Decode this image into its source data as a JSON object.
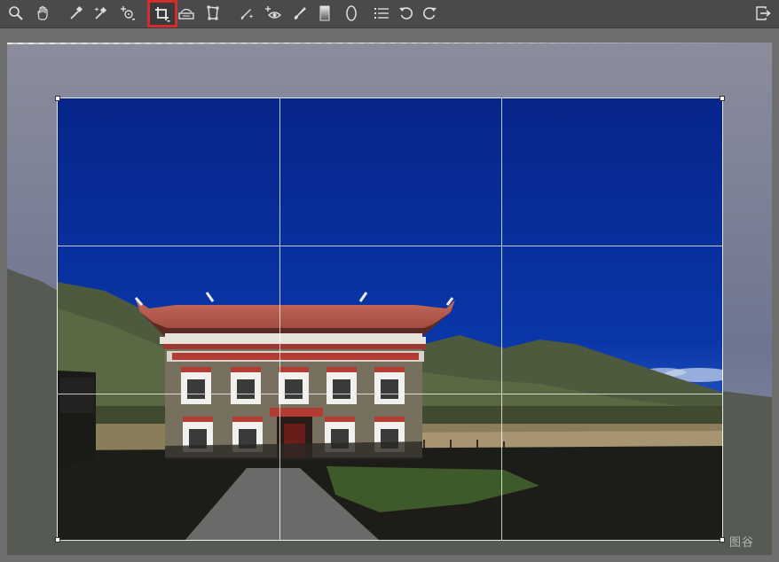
{
  "toolbar": {
    "tools": [
      {
        "name": "zoom",
        "icon": "magnifier-icon"
      },
      {
        "name": "hand",
        "icon": "hand-icon"
      },
      {
        "name": "color-picker",
        "icon": "eyedropper-icon"
      },
      {
        "name": "white-balance-picker",
        "icon": "sparkle-eyedropper-icon"
      },
      {
        "name": "color-sampler",
        "icon": "target-plus-icon"
      },
      {
        "name": "crop",
        "icon": "crop-icon",
        "active": true
      },
      {
        "name": "straighten",
        "icon": "level-icon"
      },
      {
        "name": "transform",
        "icon": "transform-icon"
      },
      {
        "name": "spot-removal",
        "icon": "brush-sparkle-icon"
      },
      {
        "name": "red-eye",
        "icon": "eye-plus-icon"
      },
      {
        "name": "adjustment-brush",
        "icon": "paintbrush-icon"
      },
      {
        "name": "graduated-filter",
        "icon": "gradient-rect-icon"
      },
      {
        "name": "radial-filter",
        "icon": "ellipse-icon"
      },
      {
        "name": "preferences",
        "icon": "list-icon"
      },
      {
        "name": "rotate-left",
        "icon": "rotate-ccw-icon"
      },
      {
        "name": "rotate-right",
        "icon": "rotate-cw-icon"
      },
      {
        "name": "export",
        "icon": "export-icon"
      }
    ],
    "accent_active": "#d32d2d"
  },
  "viewer": {
    "crop_grid": "rule-of-thirds",
    "watermark": "图谷"
  },
  "colors": {
    "sky": "#0a2f9a",
    "roof": "#b5544a",
    "wall": "#77705f"
  }
}
